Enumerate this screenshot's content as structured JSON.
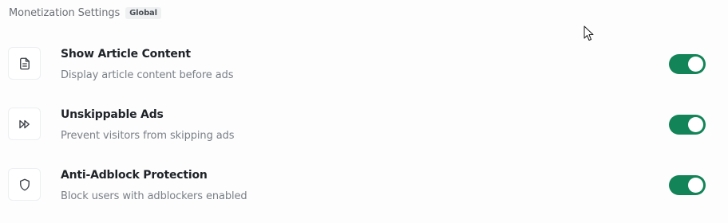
{
  "header": {
    "title": "Monetization Settings",
    "badge": "Global"
  },
  "settings": [
    {
      "title": "Show Article Content",
      "description": "Display article content before ads",
      "icon": "document-icon",
      "enabled": true
    },
    {
      "title": "Unskippable Ads",
      "description": "Prevent visitors from skipping ads",
      "icon": "fast-forward-icon",
      "enabled": true
    },
    {
      "title": "Anti-Adblock Protection",
      "description": "Block users with adblockers enabled",
      "icon": "shield-icon",
      "enabled": true
    }
  ],
  "colors": {
    "toggle_on": "#128457",
    "text_primary": "#1f2328",
    "text_secondary": "#7a7f86"
  }
}
